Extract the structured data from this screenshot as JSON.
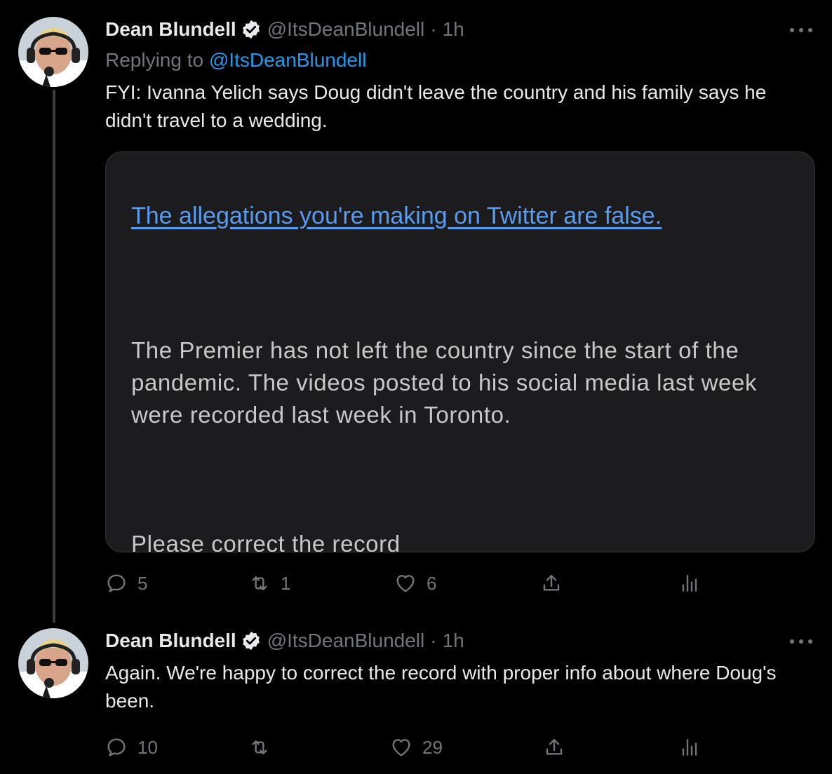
{
  "thread": {
    "tweets": [
      {
        "author_name": "Dean Blundell",
        "handle": "@ItsDeanBlundell",
        "separator": "·",
        "time": "1h",
        "replying_prefix": "Replying to",
        "replying_to": "@ItsDeanBlundell",
        "text": "FYI: Ivanna Yelich says Doug didn't leave the country and his family says he didn't travel to a wedding.",
        "media": {
          "link_text": "The allegations you're making on Twitter are false.",
          "paragraph": "The Premier has not left the country since the start of the pandemic. The videos posted to his social media last week were recorded last week in Toronto.",
          "cut_text": "Please correct the record"
        },
        "actions": {
          "replies": "5",
          "retweets": "1",
          "likes": "6",
          "share": "",
          "analytics": ""
        }
      },
      {
        "author_name": "Dean Blundell",
        "handle": "@ItsDeanBlundell",
        "separator": "·",
        "time": "1h",
        "text": "Again.  We're happy to correct the record with proper info about where Doug's been.",
        "actions": {
          "replies": "10",
          "retweets": "",
          "likes": "29",
          "share": "",
          "analytics": ""
        }
      }
    ]
  },
  "colors": {
    "background": "#000000",
    "accent": "#1d9bf0",
    "secondary_text": "#71767b",
    "primary_text": "#e7e9ea"
  },
  "icons": [
    "verified-badge-icon",
    "more-icon",
    "reply-icon",
    "retweet-icon",
    "like-icon",
    "share-icon",
    "analytics-icon"
  ]
}
